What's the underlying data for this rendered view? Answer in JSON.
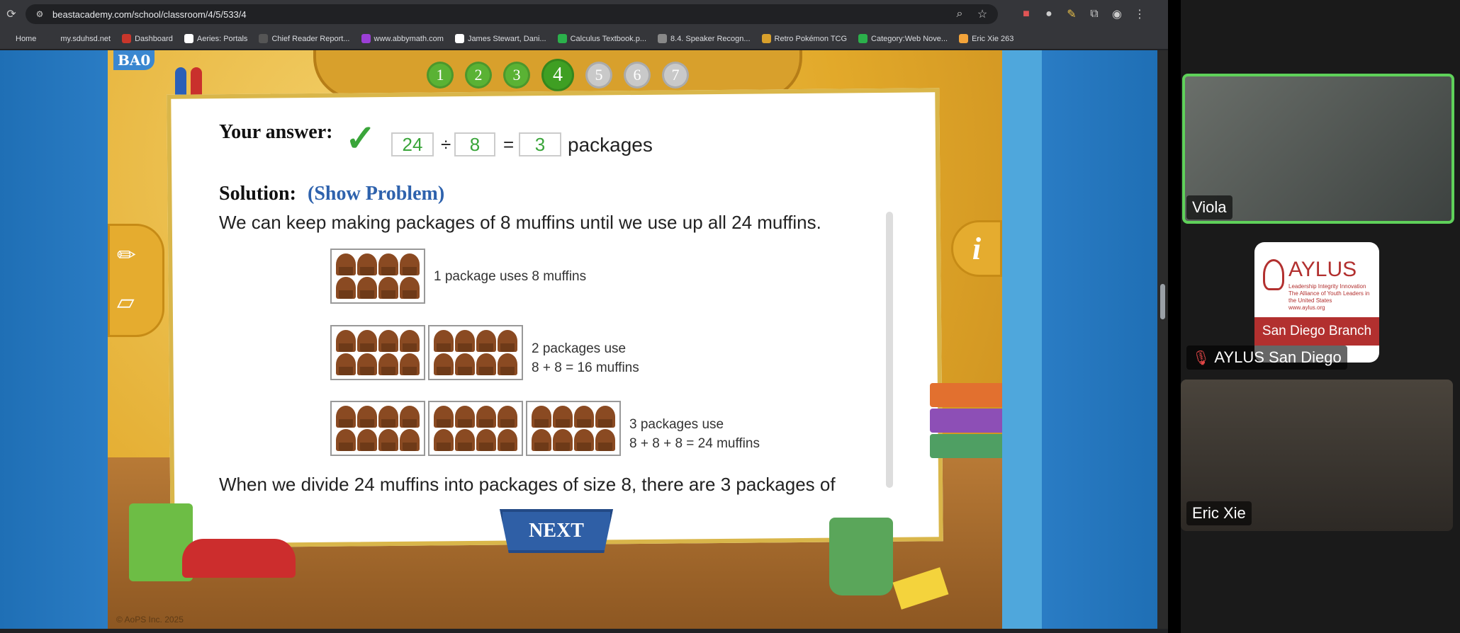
{
  "browser": {
    "url": "beastacademy.com/school/classroom/4/5/533/4",
    "bookmarks": [
      {
        "label": "Home",
        "color": "#35363a"
      },
      {
        "label": "my.sduhsd.net",
        "color": "#35363a"
      },
      {
        "label": "Dashboard",
        "color": "#c8362b"
      },
      {
        "label": "Aeries: Portals",
        "color": "#ffffff"
      },
      {
        "label": "Chief Reader Report...",
        "color": "#555555"
      },
      {
        "label": "www.abbymath.com",
        "color": "#9b3fd6"
      },
      {
        "label": "James Stewart, Dani...",
        "color": "#ffffff"
      },
      {
        "label": "Calculus Textbook.p...",
        "color": "#2bb04b"
      },
      {
        "label": "8.4. Speaker Recogn...",
        "color": "#888888"
      },
      {
        "label": "Retro Pokémon TCG",
        "color": "#d8a02c"
      },
      {
        "label": "Category:Web Nove...",
        "color": "#2bb04b"
      },
      {
        "label": "Eric Xie 263",
        "color": "#f2a33a"
      }
    ]
  },
  "game": {
    "logo": "BA0",
    "progress": [
      {
        "label": "1",
        "state": "done"
      },
      {
        "label": "2",
        "state": "done"
      },
      {
        "label": "3",
        "state": "done"
      },
      {
        "label": "4",
        "state": "current"
      },
      {
        "label": "5",
        "state": "todo"
      },
      {
        "label": "6",
        "state": "todo"
      },
      {
        "label": "7",
        "state": "todo"
      }
    ],
    "answer": {
      "label": "Your answer:",
      "check": "✓",
      "dividend": "24",
      "divide_sign": "÷",
      "divisor": "8",
      "equals_sign": "=",
      "quotient": "3",
      "unit": "packages"
    },
    "solution": {
      "label": "Solution:",
      "show_problem": "(Show Problem)",
      "intro": "We can keep making packages of 8 muffins until we use up all 24 muffins.",
      "rows": [
        {
          "packages": 1,
          "line1": "1 package uses 8 muffins",
          "line2": ""
        },
        {
          "packages": 2,
          "line1": "2 packages use",
          "line2": "8 + 8 = 16 muffins"
        },
        {
          "packages": 3,
          "line1": "3 packages use",
          "line2": "8 + 8 + 8 = 24 muffins"
        }
      ],
      "conclusion": "When we divide 24 muffins into packages of size 8, there are 3 packages of"
    },
    "next_label": "NEXT",
    "copyright": "© AoPS Inc. 2025",
    "info_glyph": "i"
  },
  "zoom": {
    "participants": [
      {
        "name": "Viola",
        "muted": false
      },
      {
        "name": "AYLUS San Diego",
        "muted": true
      },
      {
        "name": "Eric Xie",
        "muted": false
      }
    ],
    "aylus_card": {
      "title": "AYLUS",
      "tagline": "Leadership Integrity Innovation",
      "subtitle": "The Alliance of Youth Leaders in the United States",
      "website": "www.aylus.org",
      "branch": "San Diego Branch"
    }
  }
}
